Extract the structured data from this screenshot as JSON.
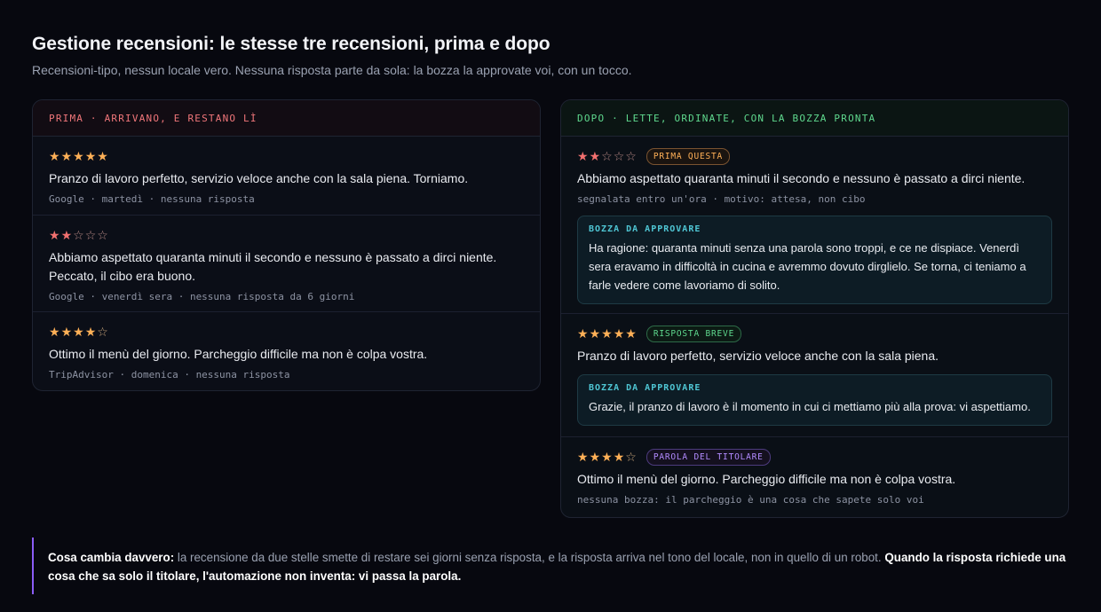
{
  "page": {
    "title": "Gestione recensioni: le stesse tre recensioni, prima e dopo",
    "subtitle": "Recensioni-tipo, nessun locale vero. Nessuna risposta parte da sola: la bozza la approvate voi, con un tocco."
  },
  "before": {
    "header": "PRIMA · ARRIVANO, E RESTANO LÌ",
    "reviews": [
      {
        "rating": 5,
        "text": "Pranzo di lavoro perfetto, servizio veloce anche con la sala piena. Torniamo.",
        "meta": "Google · martedì · nessuna risposta"
      },
      {
        "rating": 2,
        "text": "Abbiamo aspettato quaranta minuti il secondo e nessuno è passato a dirci niente. Peccato, il cibo era buono.",
        "meta": "Google · venerdì sera · nessuna risposta da 6 giorni"
      },
      {
        "rating": 4,
        "text": "Ottimo il menù del giorno. Parcheggio difficile ma non è colpa vostra.",
        "meta": "TripAdvisor · domenica · nessuna risposta"
      }
    ]
  },
  "after": {
    "header": "DOPO · LETTE, ORDINATE, CON LA BOZZA PRONTA",
    "reviews": [
      {
        "rating": 2,
        "badge": "PRIMA QUESTA",
        "text": "Abbiamo aspettato quaranta minuti il secondo e nessuno è passato a dirci niente.",
        "meta": "segnalata entro un'ora · motivo: attesa, non cibo",
        "draft_label": "BOZZA DA APPROVARE",
        "draft_text": "Ha ragione: quaranta minuti senza una parola sono troppi, e ce ne dispiace. Venerdì sera eravamo in difficoltà in cucina e avremmo dovuto dirglielo. Se torna, ci teniamo a farle vedere come lavoriamo di solito."
      },
      {
        "rating": 5,
        "badge": "RISPOSTA BREVE",
        "text": "Pranzo di lavoro perfetto, servizio veloce anche con la sala piena.",
        "draft_label": "BOZZA DA APPROVARE",
        "draft_text": "Grazie, il pranzo di lavoro è il momento in cui ci mettiamo più alla prova: vi aspettiamo."
      },
      {
        "rating": 4,
        "badge": "PAROLA DEL TITOLARE",
        "text": "Ottimo il menù del giorno. Parcheggio difficile ma non è colpa vostra.",
        "meta": "nessuna bozza: il parcheggio è una cosa che sapete solo voi"
      }
    ]
  },
  "footer": {
    "lead": "Cosa cambia davvero:",
    "body": " la recensione da due stelle smette di restare sei giorni senza risposta, e la risposta arriva nel tono del locale, non in quello di un robot. ",
    "emphasis": "Quando la risposta richiede una cosa che sa solo il titolare, l'automazione non inventa: vi passa la parola."
  },
  "colors": {
    "background": "#07080f",
    "before_accent": "#f0767a",
    "after_accent": "#5fd98e",
    "star": "#ffb057",
    "star_low": "#f2706f",
    "draft_label": "#4fc6d4",
    "footer_border": "#8a5cf6"
  },
  "icons": {
    "star_full": "star-filled-icon",
    "star_empty": "star-outline-icon"
  }
}
